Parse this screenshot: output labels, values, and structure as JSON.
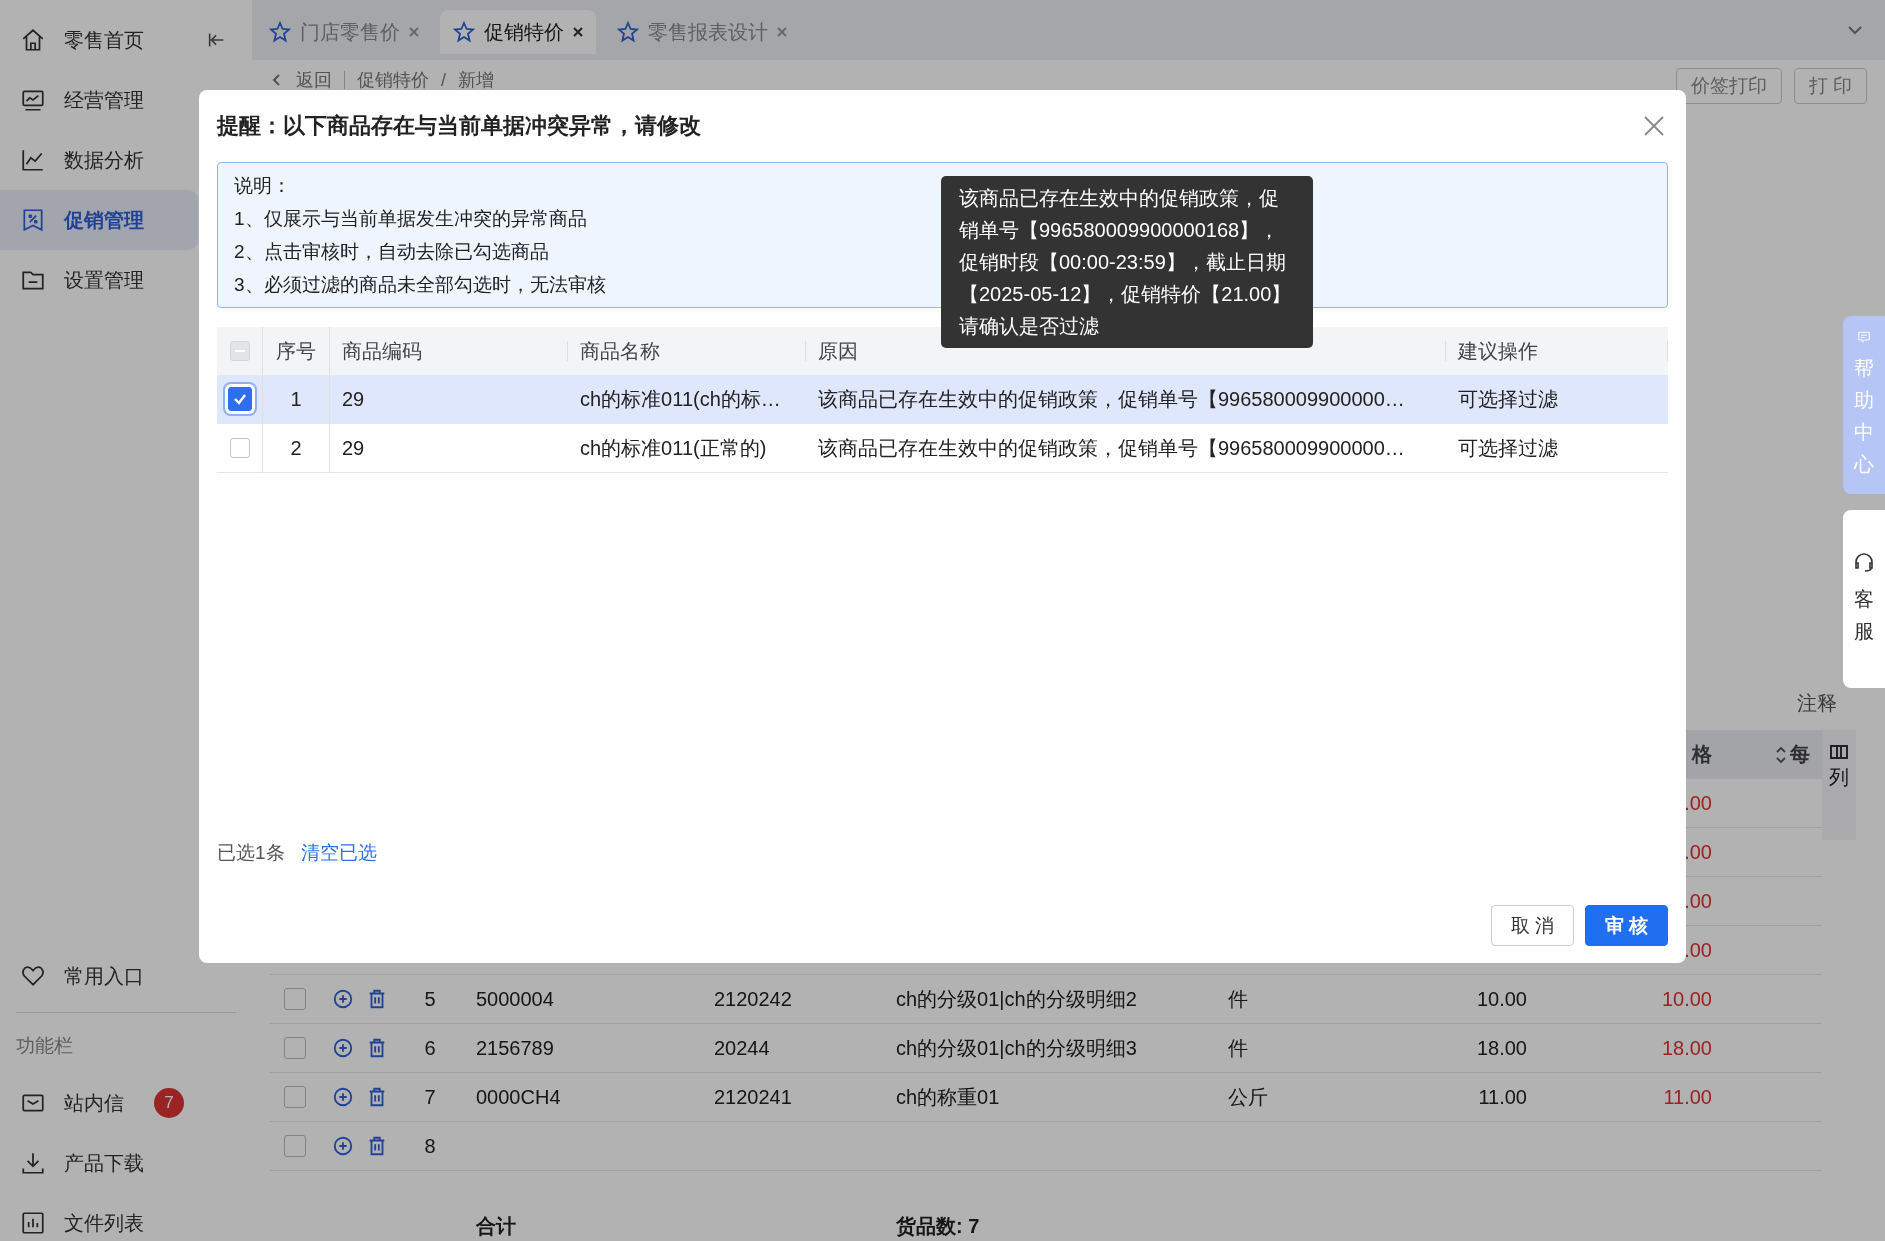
{
  "sidebar": {
    "items": [
      {
        "label": "零售首页",
        "selected": false
      },
      {
        "label": "经营管理",
        "selected": false
      },
      {
        "label": "数据分析",
        "selected": false
      },
      {
        "label": "促销管理",
        "selected": true
      },
      {
        "label": "设置管理",
        "selected": false
      }
    ],
    "favorites": "常用入口",
    "section_title": "功能栏",
    "tools": [
      {
        "label": "站内信",
        "badge": "7"
      },
      {
        "label": "产品下载"
      },
      {
        "label": "文件列表"
      }
    ]
  },
  "tabs": [
    {
      "label": "门店零售价",
      "selected": false
    },
    {
      "label": "促销特价",
      "selected": true
    },
    {
      "label": "零售报表设计",
      "selected": false
    }
  ],
  "breadcrumb": {
    "back": "返回",
    "path": [
      "促销特价",
      "新增"
    ],
    "separator": "/"
  },
  "toolbar_buttons": [
    "价签打印",
    "打 印"
  ],
  "side_widgets": [
    {
      "kind": "help",
      "label": "帮助中心"
    },
    {
      "kind": "service",
      "label": "客服"
    }
  ],
  "note_label": "注释",
  "table": {
    "columns": [
      {
        "label": "格",
        "sortable": false
      },
      {
        "label": "每",
        "sortable": true
      }
    ],
    "column_settings": "列",
    "rows": [
      {
        "sale_price": ".00"
      },
      {
        "sale_price": ".00"
      },
      {
        "sale_price": ".00"
      },
      {
        "sale_price": ".00"
      },
      {
        "checked": false,
        "index": "5",
        "code": "5000004",
        "barcode": "2120242",
        "name": "ch的分级01|ch的分级明细2",
        "unit": "件",
        "price": "10.00",
        "sale_price": "10.00"
      },
      {
        "checked": false,
        "index": "6",
        "code": "2156789",
        "barcode": "20244",
        "name": "ch的分级01|ch的分级明细3",
        "unit": "件",
        "price": "18.00",
        "sale_price": "18.00"
      },
      {
        "checked": false,
        "index": "7",
        "code": "0000CH4",
        "barcode": "2120241",
        "name": "ch的称重01",
        "unit": "公斤",
        "price": "11.00",
        "sale_price": "11.00"
      },
      {
        "checked": false,
        "index": "8"
      }
    ],
    "summary": {
      "label": "合计",
      "count": "货品数: 7"
    }
  },
  "dialog": {
    "title": "提醒：以下商品存在与当前单据冲突异常，请修改",
    "info": {
      "heading": "说明：",
      "lines": [
        "1、仅展示与当前单据发生冲突的异常商品",
        "2、点击审核时，自动去除已勾选商品",
        "3、必须过滤的商品未全部勾选时，无法审核"
      ]
    },
    "select_all": {
      "indeterminate": true
    },
    "columns": [
      "序号",
      "商品编码",
      "商品名称",
      "原因",
      "建议操作"
    ],
    "rows": [
      {
        "selected": true,
        "index": "1",
        "code": "29",
        "name": "ch的标准011(ch的标…",
        "reason": "该商品已存在生效中的促销政策，促销单号【996580009900000…",
        "action": "可选择过滤"
      },
      {
        "selected": false,
        "index": "2",
        "code": "29",
        "name": "ch的标准011(正常的)",
        "reason": "该商品已存在生效中的促销政策，促销单号【996580009900000…",
        "action": "可选择过滤"
      }
    ],
    "tooltip": "该商品已存在生效中的促销政策，促销单号【996580009900000168】，促销时段【00:00-23:59】，截止日期【2025-05-12】，促销特价【21.00】请确认是否过滤",
    "selection_count": "已选1条",
    "clear_link": "清空已选",
    "buttons": [
      {
        "label": "取 消",
        "kind": "default"
      },
      {
        "label": "审 核",
        "kind": "primary"
      }
    ]
  }
}
